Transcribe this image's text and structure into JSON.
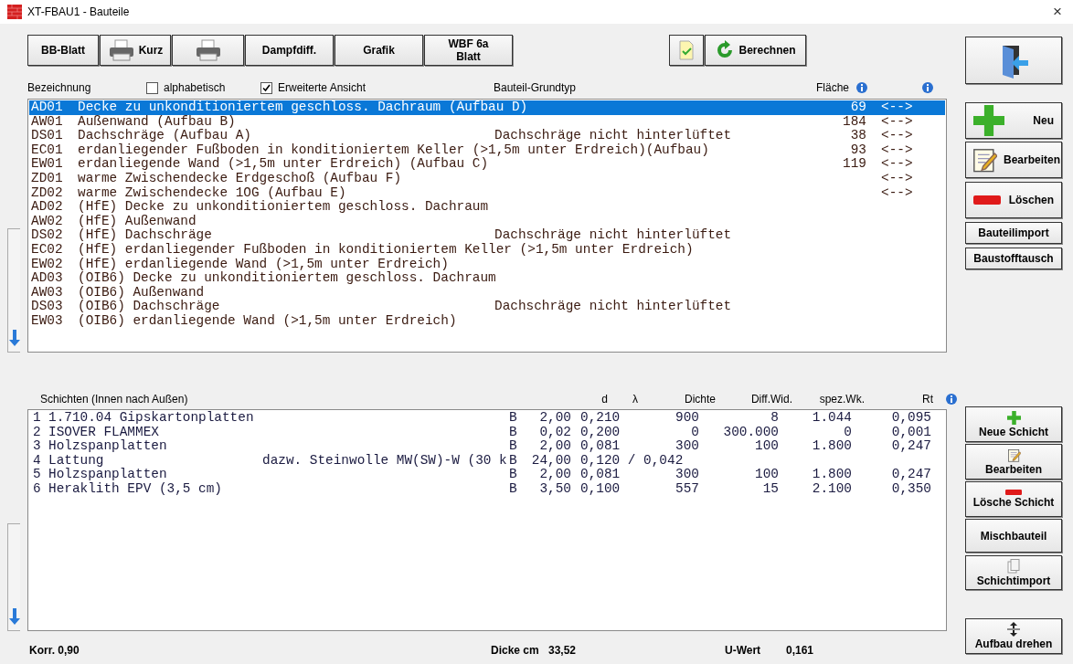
{
  "window": {
    "title": "XT-FBAU1 - Bauteile",
    "close": "×"
  },
  "toolbar": [
    {
      "kind": "text",
      "label": "BB-Blatt"
    },
    {
      "kind": "printer",
      "label": "Kurz"
    },
    {
      "kind": "printer"
    },
    {
      "kind": "text",
      "label": "Dampfdiff."
    },
    {
      "kind": "text",
      "label": "Grafik"
    },
    {
      "kind": "text",
      "label": "WBF 6a Blatt"
    }
  ],
  "actions": [
    {
      "kind": "check"
    },
    {
      "kind": "refresh",
      "label": "Berechnen"
    }
  ],
  "list_header": {
    "name": "Bezeichnung",
    "type": "Bauteil-Grundtyp",
    "area": "Fläche",
    "options": [
      {
        "label": "alphabetisch",
        "checked": false
      },
      {
        "label": "Erweiterte Ansicht",
        "checked": true
      }
    ]
  },
  "components": [
    {
      "code": "AD01",
      "name": "Decke zu unkonditioniertem geschloss. Dachraum (Aufbau D)",
      "area": "69",
      "link": "<-->",
      "selected": true
    },
    {
      "code": "AW01",
      "name": "Außenwand (Aufbau B)",
      "area": "184",
      "link": "<-->",
      "selected": false
    },
    {
      "code": "DS01",
      "name": "Dachschräge (Aufbau A)",
      "type": "Dachschräge nicht hinterlüftet",
      "area": "38",
      "link": "<-->",
      "selected": false
    },
    {
      "code": "EC01",
      "name": "erdanliegender Fußboden in konditioniertem Keller (>1,5m unter Erdreich)(Aufbau)",
      "area": "93",
      "link": "<-->",
      "selected": false
    },
    {
      "code": "EW01",
      "name": "erdanliegende Wand (>1,5m unter Erdreich) (Aufbau C)",
      "area": "119",
      "link": "<-->",
      "selected": false
    },
    {
      "code": "ZD01",
      "name": "warme Zwischendecke Erdgeschoß (Aufbau F)",
      "link": "<-->",
      "selected": false
    },
    {
      "code": "ZD02",
      "name": "warme Zwischendecke 1OG (Aufbau E)",
      "link": "<-->",
      "selected": false
    },
    {
      "code": "AD02",
      "name": "(HfE) Decke zu unkonditioniertem geschloss. Dachraum",
      "selected": false
    },
    {
      "code": "AW02",
      "name": "(HfE) Außenwand",
      "selected": false
    },
    {
      "code": "DS02",
      "name": "(HfE) Dachschräge",
      "type": "Dachschräge nicht hinterlüftet",
      "selected": false
    },
    {
      "code": "EC02",
      "name": "(HfE) erdanliegender Fußboden in konditioniertem Keller (>1,5m unter Erdreich)",
      "selected": false
    },
    {
      "code": "EW02",
      "name": "(HfE) erdanliegende Wand (>1,5m unter Erdreich)",
      "selected": false
    },
    {
      "code": "AD03",
      "name": "(OIB6) Decke zu unkonditioniertem geschloss. Dachraum",
      "selected": false
    },
    {
      "code": "AW03",
      "name": "(OIB6) Außenwand",
      "selected": false
    },
    {
      "code": "DS03",
      "name": "(OIB6) Dachschräge",
      "type": "Dachschräge nicht hinterlüftet",
      "selected": false
    },
    {
      "code": "EW03",
      "name": "(OIB6) erdanliegende Wand (>1,5m unter Erdreich)",
      "selected": false
    }
  ],
  "layers_header": {
    "title": "Schichten (Innen nach Außen)",
    "columns": [
      "d",
      "λ",
      "Dichte",
      "Diff.Wid.",
      "spez.Wk.",
      "Rt"
    ]
  },
  "layers": [
    {
      "nr": "1",
      "name": "1.710.04 Gipskartonplatten",
      "mark": "B",
      "d": "2,00",
      "lambda": "0,210",
      "density": "900",
      "diff": "8",
      "heat": "1.044",
      "rt": "0,095"
    },
    {
      "nr": "2",
      "name": "ISOVER FLAMMEX",
      "mark": "B",
      "d": "0,02",
      "lambda": "0,200",
      "density": "0",
      "diff": "300.000",
      "heat": "0",
      "rt": "0,001"
    },
    {
      "nr": "3",
      "name": "Holzspanplatten",
      "mark": "B",
      "d": "2,00",
      "lambda": "0,081",
      "density": "300",
      "diff": "100",
      "heat": "1.800",
      "rt": "0,247"
    },
    {
      "nr": "4",
      "name": "Lattung",
      "extra": "dazw. Steinwolle MW(SW)-W (30 k",
      "mark": "B",
      "d": "24,00",
      "lambda": "0,120 / 0,042"
    },
    {
      "nr": "5",
      "name": "Holzspanplatten",
      "mark": "B",
      "d": "2,00",
      "lambda": "0,081",
      "density": "300",
      "diff": "100",
      "heat": "1.800",
      "rt": "0,247"
    },
    {
      "nr": "6",
      "name": "Heraklith EPV (3,5 cm)",
      "mark": "B",
      "d": "3,50",
      "lambda": "0,100",
      "density": "557",
      "diff": "15",
      "heat": "2.100",
      "rt": "0,350"
    }
  ],
  "footer": {
    "korr": "Korr. 0,90",
    "thickness_label": "Dicke cm",
    "thickness": "33,52",
    "u_label": "U-Wert",
    "u": "0,161"
  },
  "side_top": [
    {
      "kind": "exit"
    },
    {
      "kind": "plus",
      "label": "Neu"
    },
    {
      "kind": "note",
      "label": "Bearbeiten"
    },
    {
      "kind": "minus",
      "label": "Löschen"
    },
    {
      "kind": "text",
      "label": "Bauteilimport"
    },
    {
      "kind": "text",
      "label": "Baustofftausch"
    }
  ],
  "side_bottom": [
    {
      "kind": "plus",
      "label": "Neue Schicht"
    },
    {
      "kind": "note",
      "label": "Bearbeiten"
    },
    {
      "kind": "minus",
      "label": "Lösche Schicht"
    },
    {
      "kind": "text",
      "label": "Mischbauteil"
    },
    {
      "kind": "doc",
      "label": "Schichtimport"
    },
    {
      "kind": "flip",
      "label": "Aufbau drehen"
    }
  ]
}
